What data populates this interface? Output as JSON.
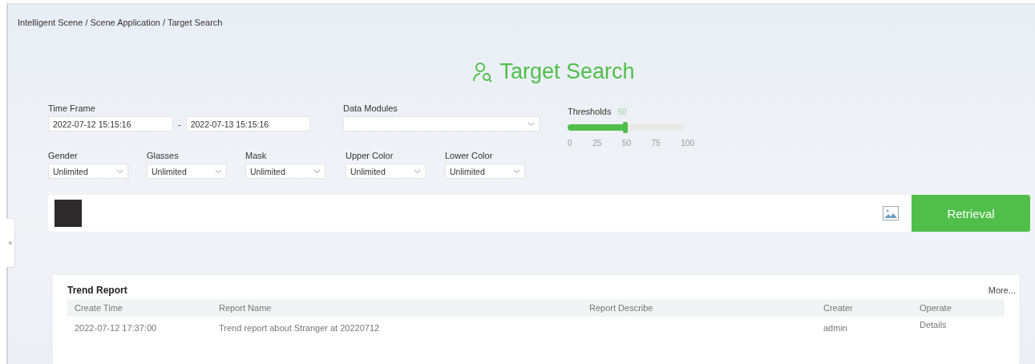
{
  "breadcrumb": "Intelligent Scene / Scene Application / Target Search",
  "collapse_toggle": "«",
  "title": "Target Search",
  "time_frame": {
    "label": "Time Frame",
    "start": "2022-07-12 15:15:16",
    "separator": "-",
    "end": "2022-07-13 15:15:16"
  },
  "data_modules": {
    "label": "Data Modules"
  },
  "thresholds": {
    "label": "Thresholds",
    "reading": "50",
    "level": 0.5,
    "ticks": [
      "0",
      "25",
      "50",
      "75",
      "100"
    ]
  },
  "attribute_filters": [
    {
      "label": "Gender",
      "value": "Unlimited"
    },
    {
      "label": "Glasses",
      "value": "Unlimited"
    },
    {
      "label": "Mask",
      "value": "Unlimited"
    },
    {
      "label": "Upper Color",
      "value": "Unlimited"
    },
    {
      "label": "Lower Color",
      "value": "Unlimited"
    }
  ],
  "search_button": "Retrieval",
  "trend_report": {
    "title": "Trend Report",
    "more": "More...",
    "columns": [
      "Create Time",
      "Report Name",
      "Report Describe",
      "Creater",
      "Operate"
    ],
    "rows": [
      {
        "create_time": "2022-07-12 17:37:00",
        "report_name": "Trend report about Stranger at 20220712",
        "report_describe": "",
        "creater": "admin",
        "operate": "Details"
      }
    ]
  }
}
